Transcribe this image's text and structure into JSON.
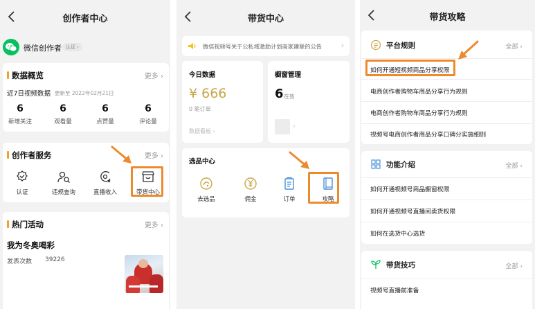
{
  "creator": {
    "title": "创作者中心",
    "account_name": "微信创作者",
    "verified_badge": "认证",
    "overview": {
      "title": "数据概览",
      "more": "更多",
      "period": "近7日视频数据",
      "updated": "更新至 2022年02月21日",
      "stats": [
        {
          "value": "6",
          "label": "新增关注"
        },
        {
          "value": "6",
          "label": "观看量"
        },
        {
          "value": "6",
          "label": "点赞量"
        },
        {
          "value": "6",
          "label": "评论量"
        }
      ]
    },
    "services": {
      "title": "创作者服务",
      "more": "更多",
      "items": [
        {
          "label": "认证",
          "icon": "verify-icon"
        },
        {
          "label": "违规查询",
          "icon": "person-search-icon"
        },
        {
          "label": "直播收入",
          "icon": "live-income-icon"
        },
        {
          "label": "带货中心",
          "icon": "store-icon"
        }
      ]
    },
    "activities": {
      "title": "热门活动",
      "more": "更多",
      "activity_title": "我为冬奥喝彩",
      "post_count_label": "发表次数",
      "post_count": "39226"
    }
  },
  "commerce": {
    "title": "带货中心",
    "notice": "微信视频号关于公私域激励计划商家建联的公告",
    "today": {
      "title": "今日数据",
      "amount": "¥ 666",
      "orders": "0 笔订单",
      "dashboard_link": "数据看板"
    },
    "showcase": {
      "title": "橱窗管理",
      "count": "6",
      "unit": "在售"
    },
    "selection": {
      "title": "选品中心",
      "items": [
        {
          "label": "去选品",
          "icon": "select-icon"
        },
        {
          "label": "佣金",
          "icon": "yen-icon"
        },
        {
          "label": "订单",
          "icon": "order-icon"
        },
        {
          "label": "攻略",
          "icon": "guide-book-icon"
        }
      ]
    }
  },
  "guide": {
    "title": "带货攻略",
    "sections": [
      {
        "title": "平台规则",
        "all": "全部",
        "articles": [
          "如何开通短视频商品分享权限",
          "电商创作者购物车商品分享行为规则",
          "电商创作者购物车商品分享行为规则",
          "视频号电商创作者商品分享口碑分实施细则"
        ]
      },
      {
        "title": "功能介绍",
        "all": "全部",
        "articles": [
          "如何开通视频号商品橱窗权限",
          "如何开通视频号直播间卖货权限",
          "如何在选货中心选货"
        ]
      },
      {
        "title": "带货技巧",
        "all": "全部",
        "articles": [
          "视频号直播前准备"
        ]
      }
    ]
  },
  "colors": {
    "accent_orange": "#ee8a2e",
    "wechat_green": "#07c160",
    "gold": "#c9a64a",
    "section_bar": "#f0a030"
  }
}
